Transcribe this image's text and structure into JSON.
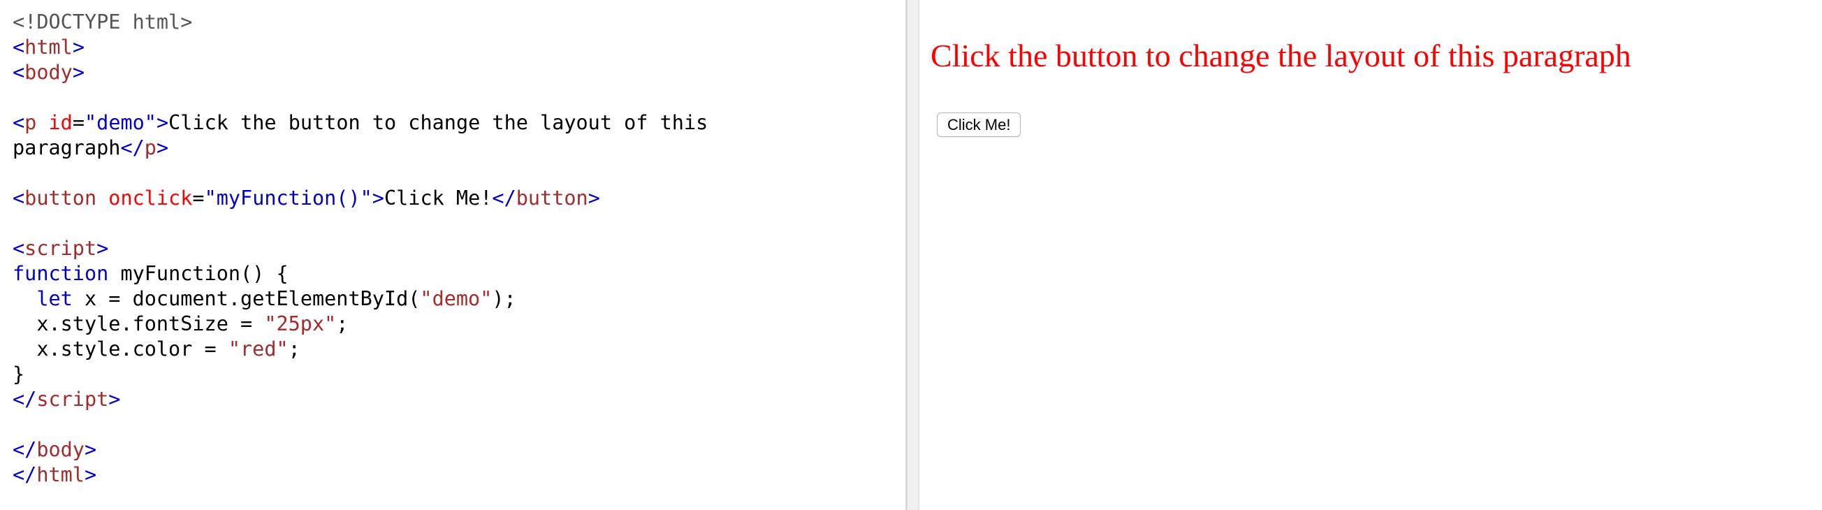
{
  "editor": {
    "lines": [
      [
        {
          "t": "<!DOCTYPE html>",
          "c": "doctype"
        }
      ],
      [
        {
          "t": "<",
          "c": "bracket"
        },
        {
          "t": "html",
          "c": "tag"
        },
        {
          "t": ">",
          "c": "bracket"
        }
      ],
      [
        {
          "t": "<",
          "c": "bracket"
        },
        {
          "t": "body",
          "c": "tag"
        },
        {
          "t": ">",
          "c": "bracket"
        }
      ],
      [],
      [
        {
          "t": "<",
          "c": "bracket"
        },
        {
          "t": "p",
          "c": "tag"
        },
        {
          "t": " ",
          "c": "plain"
        },
        {
          "t": "id",
          "c": "attr"
        },
        {
          "t": "=",
          "c": "eq"
        },
        {
          "t": "\"demo\"",
          "c": "string"
        },
        {
          "t": ">",
          "c": "bracket"
        },
        {
          "t": "Click the button to change the layout of this",
          "c": "plain"
        }
      ],
      [
        {
          "t": "paragraph",
          "c": "plain"
        },
        {
          "t": "</",
          "c": "bracket"
        },
        {
          "t": "p",
          "c": "tag"
        },
        {
          "t": ">",
          "c": "bracket"
        }
      ],
      [],
      [
        {
          "t": "<",
          "c": "bracket"
        },
        {
          "t": "button",
          "c": "tag"
        },
        {
          "t": " ",
          "c": "plain"
        },
        {
          "t": "onclick",
          "c": "attr"
        },
        {
          "t": "=",
          "c": "eq"
        },
        {
          "t": "\"myFunction()\"",
          "c": "string"
        },
        {
          "t": ">",
          "c": "bracket"
        },
        {
          "t": "Click Me!",
          "c": "plain"
        },
        {
          "t": "</",
          "c": "bracket"
        },
        {
          "t": "button",
          "c": "tag"
        },
        {
          "t": ">",
          "c": "bracket"
        }
      ],
      [],
      [
        {
          "t": "<",
          "c": "bracket"
        },
        {
          "t": "script",
          "c": "tag"
        },
        {
          "t": ">",
          "c": "bracket"
        }
      ],
      [
        {
          "t": "function",
          "c": "kw"
        },
        {
          "t": " myFunction() {",
          "c": "plain"
        }
      ],
      [
        {
          "t": "  ",
          "c": "plain"
        },
        {
          "t": "let",
          "c": "kw"
        },
        {
          "t": " x = document.getElementById(",
          "c": "plain"
        },
        {
          "t": "\"demo\"",
          "c": "jsstring"
        },
        {
          "t": ");",
          "c": "plain"
        }
      ],
      [
        {
          "t": "  x.style.fontSize = ",
          "c": "plain"
        },
        {
          "t": "\"25px\"",
          "c": "jsstring"
        },
        {
          "t": ";",
          "c": "plain"
        }
      ],
      [
        {
          "t": "  x.style.color = ",
          "c": "plain"
        },
        {
          "t": "\"red\"",
          "c": "jsstring"
        },
        {
          "t": ";",
          "c": "plain"
        }
      ],
      [
        {
          "t": "}",
          "c": "plain"
        }
      ],
      [
        {
          "t": "</",
          "c": "bracket"
        },
        {
          "t": "script",
          "c": "tag"
        },
        {
          "t": ">",
          "c": "bracket"
        }
      ],
      [],
      [
        {
          "t": "</",
          "c": "bracket"
        },
        {
          "t": "body",
          "c": "tag"
        },
        {
          "t": ">",
          "c": "bracket"
        }
      ],
      [
        {
          "t": "</",
          "c": "bracket"
        },
        {
          "t": "html",
          "c": "tag"
        },
        {
          "t": ">",
          "c": "bracket"
        }
      ]
    ]
  },
  "preview": {
    "paragraph_text": "Click the button to change the layout of this paragraph",
    "paragraph_color": "#ff0000",
    "button_label": "Click Me!"
  },
  "colors": {
    "tag": "#a52a2a",
    "bracket": "#0000cd",
    "attr": "#ff0000",
    "attr_value": "#0000cd",
    "keyword": "#0000cd",
    "js_string": "#a52a2a",
    "doctype": "#555555"
  }
}
